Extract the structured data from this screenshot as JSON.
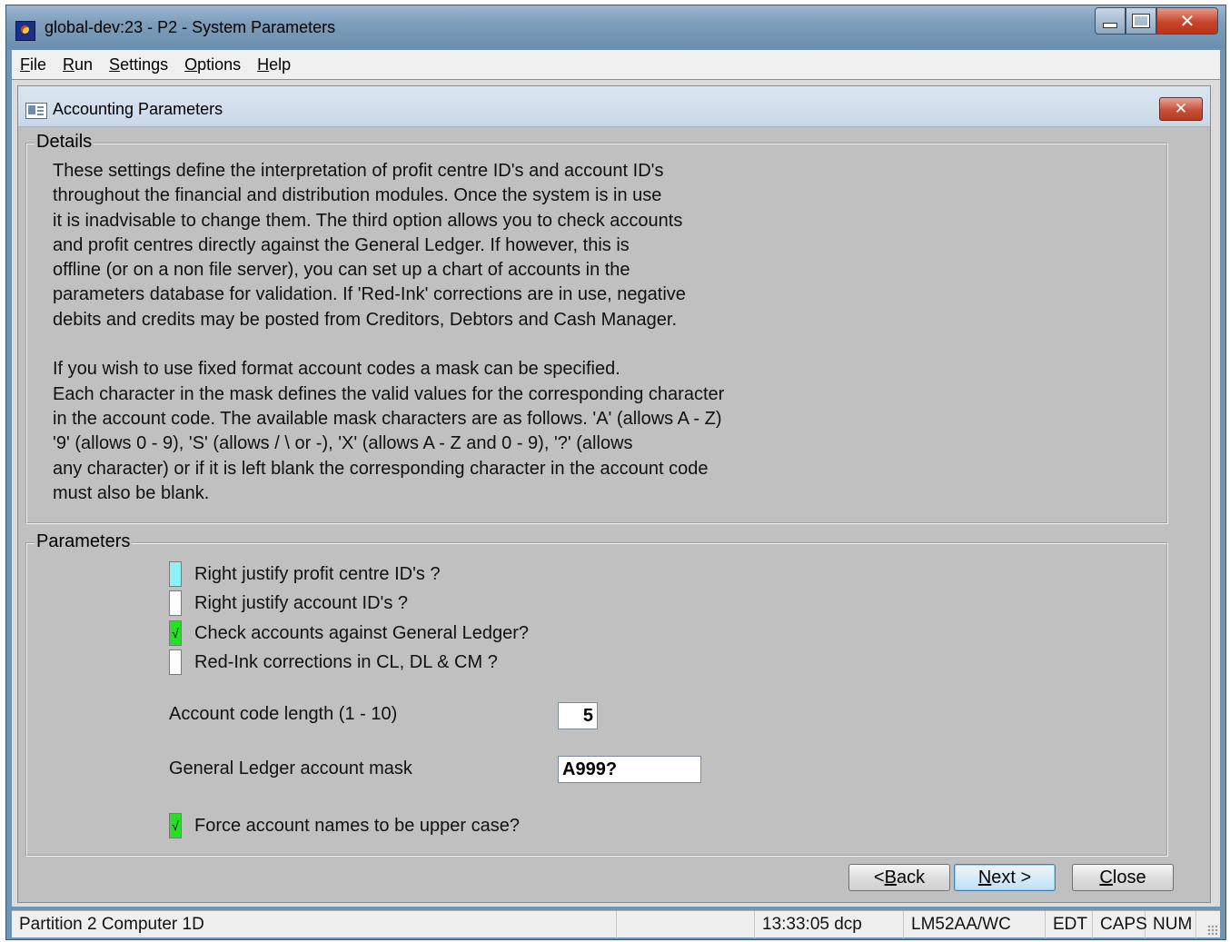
{
  "window": {
    "title": "global-dev:23 - P2 - System Parameters"
  },
  "menu": {
    "items": [
      {
        "first": "F",
        "rest": "ile"
      },
      {
        "first": "R",
        "rest": "un"
      },
      {
        "first": "S",
        "rest": "ettings"
      },
      {
        "first": "O",
        "rest": "ptions"
      },
      {
        "first": "H",
        "rest": "elp"
      }
    ]
  },
  "dialog": {
    "title": "Accounting Parameters",
    "close_glyph": "✕"
  },
  "details": {
    "label": "Details",
    "paragraph1": [
      "These settings define the interpretation of profit centre ID's and account ID's",
      "throughout the financial and distribution modules.  Once the system is in use",
      "it is inadvisable to change them.  The third option allows you to check accounts",
      "and profit centres directly against the General Ledger.  If however, this is",
      "offline (or on a non file server), you can set up a chart of accounts in the",
      "parameters database for validation.  If 'Red-Ink' corrections are in use, negative",
      "debits and credits may be posted from Creditors, Debtors and Cash Manager."
    ],
    "paragraph2": [
      "If you wish to use fixed format account codes a mask can be specified.",
      "Each character in the mask defines the valid values for the corresponding character",
      "in the account code. The available mask characters are as follows. 'A' (allows A - Z)",
      "'9' (allows 0 - 9), 'S' (allows /  \\ or -), 'X' (allows A - Z and 0 - 9), '?' (allows",
      "any character) or if it is left blank the corresponding character in the account code",
      "must also be blank."
    ]
  },
  "parameters": {
    "label": "Parameters",
    "checkboxes": [
      {
        "label": "Right justify profit centre ID's ?",
        "checked": false,
        "focused": true,
        "mark": ""
      },
      {
        "label": "Right justify account ID's ?",
        "checked": false,
        "focused": false,
        "mark": ""
      },
      {
        "label": "Check accounts against General Ledger?",
        "checked": true,
        "focused": false,
        "mark": "√"
      },
      {
        "label": "Red-Ink corrections in CL, DL & CM ?",
        "checked": false,
        "focused": false,
        "mark": ""
      }
    ],
    "code_length": {
      "label": "Account code length (1 - 10)",
      "value": "5"
    },
    "mask": {
      "label": "General Ledger account mask",
      "value": "A999?"
    },
    "force_upper": {
      "label": "Force account names to be upper case?",
      "checked": true,
      "mark": "√"
    }
  },
  "buttons": {
    "back": {
      "pre": "< ",
      "ul": "B",
      "post": "ack"
    },
    "next": {
      "pre": "",
      "ul": "N",
      "post": "ext >"
    },
    "close": {
      "pre": "",
      "ul": "C",
      "post": "lose"
    }
  },
  "status": {
    "partition": "Partition 2 Computer 1D",
    "time_user": "13:33:05  dcp",
    "terminal": "LM52AA/WC",
    "edt": "EDT",
    "caps": "CAPS",
    "num": "NUM"
  }
}
